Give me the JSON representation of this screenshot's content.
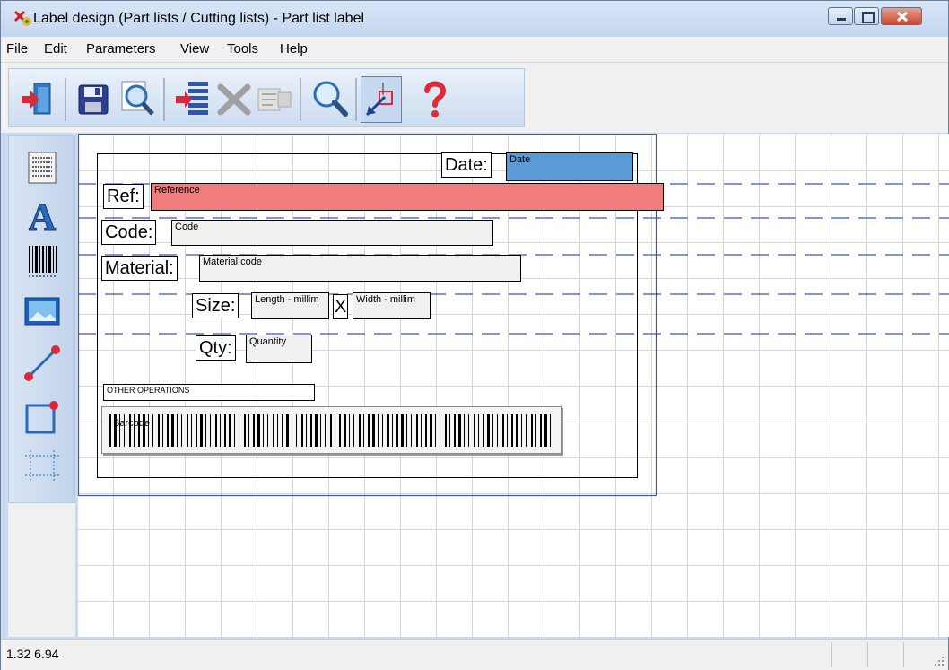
{
  "window": {
    "title": "Label design (Part lists / Cutting lists) - Part list label"
  },
  "menu": [
    "File",
    "Edit",
    "Parameters",
    "View",
    "Tools",
    "Help"
  ],
  "toolbar": {
    "buttons": [
      "exit-icon",
      "save-icon",
      "print-preview-icon",
      "insert-field-icon",
      "delete-icon",
      "properties-icon",
      "zoom-icon",
      "select-tool-icon",
      "help-icon"
    ]
  },
  "sidebar": {
    "tools": [
      "label-page-icon",
      "text-icon",
      "barcode-icon",
      "image-icon",
      "line-icon",
      "rectangle-icon",
      "grid-icon"
    ]
  },
  "label": {
    "date_label": "Date:",
    "date_field": "Date",
    "ref_label": "Ref:",
    "ref_field": "Reference",
    "code_label": "Code:",
    "code_field": "Code",
    "material_label": "Material:",
    "material_field": "Material code",
    "size_label": "Size:",
    "length_field": "Length - millim",
    "x_label": "X",
    "width_field": "Width - millim",
    "qty_label": "Qty:",
    "qty_field": "Quantity",
    "operations_field": "OTHER OPERATIONS",
    "barcode_field": "Barcode"
  },
  "colors": {
    "date_field_bg": "#5b9bd5",
    "ref_field_bg": "#f07c7c",
    "guide_line": "#3b55b8"
  },
  "statusbar": {
    "coords": "1.32 6.94"
  }
}
